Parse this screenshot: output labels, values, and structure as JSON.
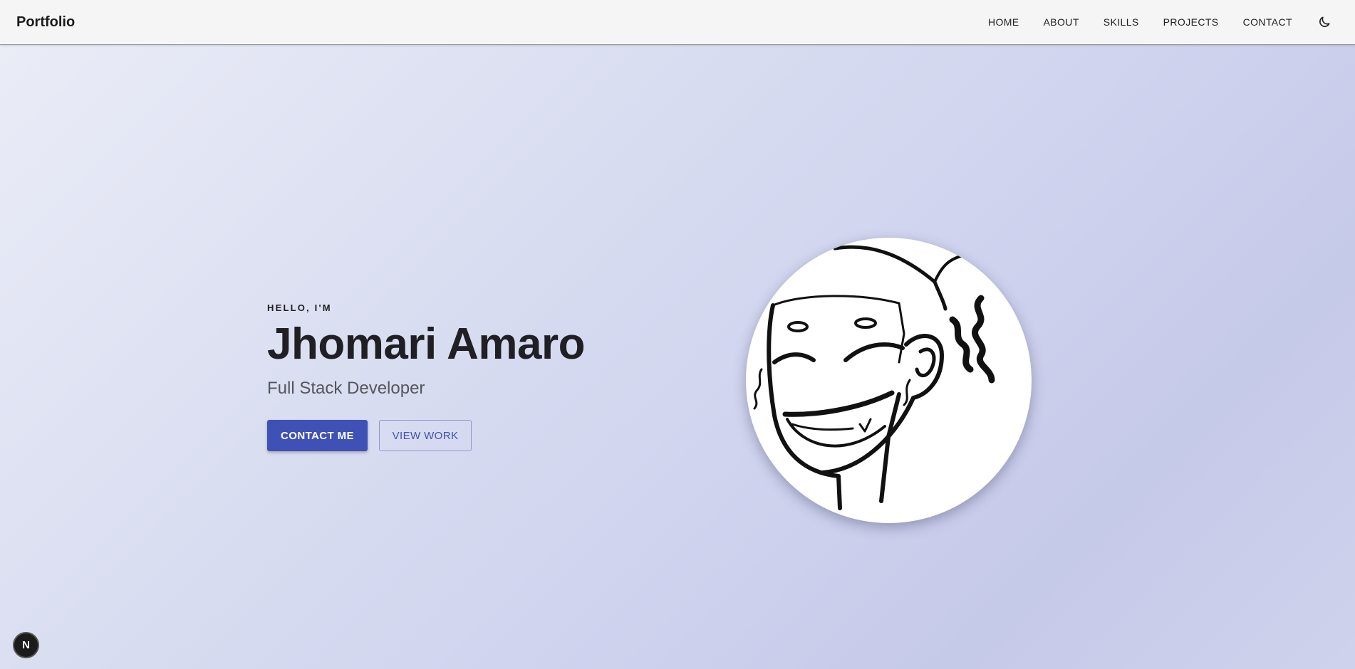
{
  "navbar": {
    "brand": "Portfolio",
    "links": [
      "HOME",
      "ABOUT",
      "SKILLS",
      "PROJECTS",
      "CONTACT"
    ],
    "theme_icon": "moon-icon"
  },
  "hero": {
    "greeting": "HELLO, I'M",
    "name": "Jhomari Amaro",
    "role": "Full Stack Developer",
    "primary_button": "CONTACT ME",
    "secondary_button": "VIEW WORK"
  },
  "avatar": {
    "icon": "cartoon-face-avatar"
  },
  "dev_badge": {
    "label": "N"
  },
  "colors": {
    "accent": "#3f51b5",
    "navbar_bg": "#f5f5f5",
    "text_primary": "#1f1f24",
    "text_secondary": "#55565d"
  }
}
